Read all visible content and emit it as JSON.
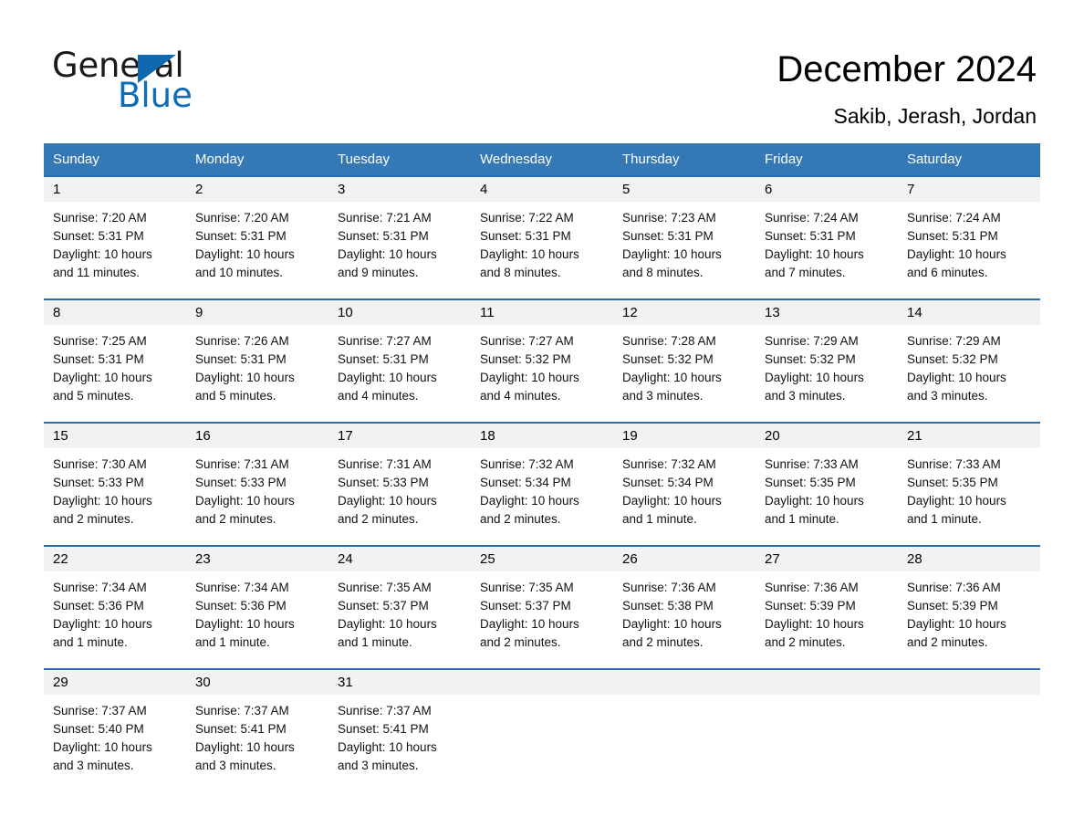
{
  "brand": {
    "name_part1": "General",
    "name_part2": "Blue",
    "accent_color": "#0d6db5"
  },
  "header": {
    "title": "December 2024",
    "location": "Sakib, Jerash, Jordan"
  },
  "calendar": {
    "header_bg": "#3479b5",
    "row_rule_color": "#2c6ca8",
    "date_band_bg": "#f2f2f2",
    "weekday_names": [
      "Sunday",
      "Monday",
      "Tuesday",
      "Wednesday",
      "Thursday",
      "Friday",
      "Saturday"
    ],
    "weeks": [
      [
        {
          "date": "1",
          "sunrise": "Sunrise: 7:20 AM",
          "sunset": "Sunset: 5:31 PM",
          "daylight_line1": "Daylight: 10 hours",
          "daylight_line2": "and 11 minutes."
        },
        {
          "date": "2",
          "sunrise": "Sunrise: 7:20 AM",
          "sunset": "Sunset: 5:31 PM",
          "daylight_line1": "Daylight: 10 hours",
          "daylight_line2": "and 10 minutes."
        },
        {
          "date": "3",
          "sunrise": "Sunrise: 7:21 AM",
          "sunset": "Sunset: 5:31 PM",
          "daylight_line1": "Daylight: 10 hours",
          "daylight_line2": "and 9 minutes."
        },
        {
          "date": "4",
          "sunrise": "Sunrise: 7:22 AM",
          "sunset": "Sunset: 5:31 PM",
          "daylight_line1": "Daylight: 10 hours",
          "daylight_line2": "and 8 minutes."
        },
        {
          "date": "5",
          "sunrise": "Sunrise: 7:23 AM",
          "sunset": "Sunset: 5:31 PM",
          "daylight_line1": "Daylight: 10 hours",
          "daylight_line2": "and 8 minutes."
        },
        {
          "date": "6",
          "sunrise": "Sunrise: 7:24 AM",
          "sunset": "Sunset: 5:31 PM",
          "daylight_line1": "Daylight: 10 hours",
          "daylight_line2": "and 7 minutes."
        },
        {
          "date": "7",
          "sunrise": "Sunrise: 7:24 AM",
          "sunset": "Sunset: 5:31 PM",
          "daylight_line1": "Daylight: 10 hours",
          "daylight_line2": "and 6 minutes."
        }
      ],
      [
        {
          "date": "8",
          "sunrise": "Sunrise: 7:25 AM",
          "sunset": "Sunset: 5:31 PM",
          "daylight_line1": "Daylight: 10 hours",
          "daylight_line2": "and 5 minutes."
        },
        {
          "date": "9",
          "sunrise": "Sunrise: 7:26 AM",
          "sunset": "Sunset: 5:31 PM",
          "daylight_line1": "Daylight: 10 hours",
          "daylight_line2": "and 5 minutes."
        },
        {
          "date": "10",
          "sunrise": "Sunrise: 7:27 AM",
          "sunset": "Sunset: 5:31 PM",
          "daylight_line1": "Daylight: 10 hours",
          "daylight_line2": "and 4 minutes."
        },
        {
          "date": "11",
          "sunrise": "Sunrise: 7:27 AM",
          "sunset": "Sunset: 5:32 PM",
          "daylight_line1": "Daylight: 10 hours",
          "daylight_line2": "and 4 minutes."
        },
        {
          "date": "12",
          "sunrise": "Sunrise: 7:28 AM",
          "sunset": "Sunset: 5:32 PM",
          "daylight_line1": "Daylight: 10 hours",
          "daylight_line2": "and 3 minutes."
        },
        {
          "date": "13",
          "sunrise": "Sunrise: 7:29 AM",
          "sunset": "Sunset: 5:32 PM",
          "daylight_line1": "Daylight: 10 hours",
          "daylight_line2": "and 3 minutes."
        },
        {
          "date": "14",
          "sunrise": "Sunrise: 7:29 AM",
          "sunset": "Sunset: 5:32 PM",
          "daylight_line1": "Daylight: 10 hours",
          "daylight_line2": "and 3 minutes."
        }
      ],
      [
        {
          "date": "15",
          "sunrise": "Sunrise: 7:30 AM",
          "sunset": "Sunset: 5:33 PM",
          "daylight_line1": "Daylight: 10 hours",
          "daylight_line2": "and 2 minutes."
        },
        {
          "date": "16",
          "sunrise": "Sunrise: 7:31 AM",
          "sunset": "Sunset: 5:33 PM",
          "daylight_line1": "Daylight: 10 hours",
          "daylight_line2": "and 2 minutes."
        },
        {
          "date": "17",
          "sunrise": "Sunrise: 7:31 AM",
          "sunset": "Sunset: 5:33 PM",
          "daylight_line1": "Daylight: 10 hours",
          "daylight_line2": "and 2 minutes."
        },
        {
          "date": "18",
          "sunrise": "Sunrise: 7:32 AM",
          "sunset": "Sunset: 5:34 PM",
          "daylight_line1": "Daylight: 10 hours",
          "daylight_line2": "and 2 minutes."
        },
        {
          "date": "19",
          "sunrise": "Sunrise: 7:32 AM",
          "sunset": "Sunset: 5:34 PM",
          "daylight_line1": "Daylight: 10 hours",
          "daylight_line2": "and 1 minute."
        },
        {
          "date": "20",
          "sunrise": "Sunrise: 7:33 AM",
          "sunset": "Sunset: 5:35 PM",
          "daylight_line1": "Daylight: 10 hours",
          "daylight_line2": "and 1 minute."
        },
        {
          "date": "21",
          "sunrise": "Sunrise: 7:33 AM",
          "sunset": "Sunset: 5:35 PM",
          "daylight_line1": "Daylight: 10 hours",
          "daylight_line2": "and 1 minute."
        }
      ],
      [
        {
          "date": "22",
          "sunrise": "Sunrise: 7:34 AM",
          "sunset": "Sunset: 5:36 PM",
          "daylight_line1": "Daylight: 10 hours",
          "daylight_line2": "and 1 minute."
        },
        {
          "date": "23",
          "sunrise": "Sunrise: 7:34 AM",
          "sunset": "Sunset: 5:36 PM",
          "daylight_line1": "Daylight: 10 hours",
          "daylight_line2": "and 1 minute."
        },
        {
          "date": "24",
          "sunrise": "Sunrise: 7:35 AM",
          "sunset": "Sunset: 5:37 PM",
          "daylight_line1": "Daylight: 10 hours",
          "daylight_line2": "and 1 minute."
        },
        {
          "date": "25",
          "sunrise": "Sunrise: 7:35 AM",
          "sunset": "Sunset: 5:37 PM",
          "daylight_line1": "Daylight: 10 hours",
          "daylight_line2": "and 2 minutes."
        },
        {
          "date": "26",
          "sunrise": "Sunrise: 7:36 AM",
          "sunset": "Sunset: 5:38 PM",
          "daylight_line1": "Daylight: 10 hours",
          "daylight_line2": "and 2 minutes."
        },
        {
          "date": "27",
          "sunrise": "Sunrise: 7:36 AM",
          "sunset": "Sunset: 5:39 PM",
          "daylight_line1": "Daylight: 10 hours",
          "daylight_line2": "and 2 minutes."
        },
        {
          "date": "28",
          "sunrise": "Sunrise: 7:36 AM",
          "sunset": "Sunset: 5:39 PM",
          "daylight_line1": "Daylight: 10 hours",
          "daylight_line2": "and 2 minutes."
        }
      ],
      [
        {
          "date": "29",
          "sunrise": "Sunrise: 7:37 AM",
          "sunset": "Sunset: 5:40 PM",
          "daylight_line1": "Daylight: 10 hours",
          "daylight_line2": "and 3 minutes."
        },
        {
          "date": "30",
          "sunrise": "Sunrise: 7:37 AM",
          "sunset": "Sunset: 5:41 PM",
          "daylight_line1": "Daylight: 10 hours",
          "daylight_line2": "and 3 minutes."
        },
        {
          "date": "31",
          "sunrise": "Sunrise: 7:37 AM",
          "sunset": "Sunset: 5:41 PM",
          "daylight_line1": "Daylight: 10 hours",
          "daylight_line2": "and 3 minutes."
        },
        {
          "date": "",
          "sunrise": "",
          "sunset": "",
          "daylight_line1": "",
          "daylight_line2": ""
        },
        {
          "date": "",
          "sunrise": "",
          "sunset": "",
          "daylight_line1": "",
          "daylight_line2": ""
        },
        {
          "date": "",
          "sunrise": "",
          "sunset": "",
          "daylight_line1": "",
          "daylight_line2": ""
        },
        {
          "date": "",
          "sunrise": "",
          "sunset": "",
          "daylight_line1": "",
          "daylight_line2": ""
        }
      ]
    ]
  }
}
